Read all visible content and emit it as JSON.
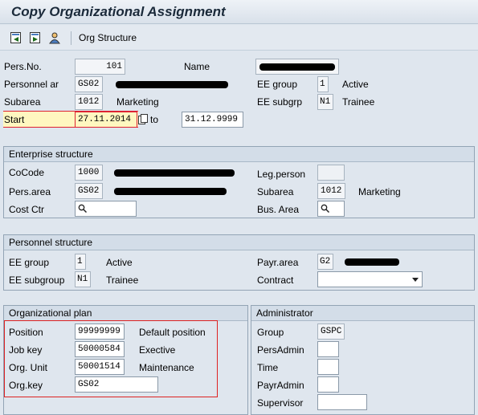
{
  "window": {
    "title": "Copy Organizational Assignment"
  },
  "toolbar": {
    "org_structure_label": "Org Structure"
  },
  "header": {
    "pers_no_label": "Pers.No.",
    "pers_no_value": "101",
    "name_label": "Name",
    "pers_area_label": "Personnel ar",
    "pers_area_value": "GS02",
    "ee_group_label": "EE group",
    "ee_group_value": "1",
    "ee_group_text": "Active",
    "subarea_label": "Subarea",
    "subarea_value": "1012",
    "subarea_text": "Marketing",
    "ee_subgrp_label": "EE subgrp",
    "ee_subgrp_value": "N1",
    "ee_subgrp_text": "Trainee",
    "start_label": "Start",
    "start_value": "27.11.2014",
    "to_label": "to",
    "end_value": "31.12.9999"
  },
  "enterprise": {
    "title": "Enterprise structure",
    "cocode_label": "CoCode",
    "cocode_value": "1000",
    "legperson_label": "Leg.person",
    "persarea_label": "Pers.area",
    "persarea_value": "GS02",
    "subarea_label": "Subarea",
    "subarea_value": "1012",
    "subarea_text": "Marketing",
    "costctr_label": "Cost Ctr",
    "busarea_label": "Bus. Area"
  },
  "personnel": {
    "title": "Personnel structure",
    "eegroup_label": "EE group",
    "eegroup_value": "1",
    "eegroup_text": "Active",
    "payrarea_label": "Payr.area",
    "payrarea_value": "G2",
    "eesubgroup_label": "EE subgroup",
    "eesubgroup_value": "N1",
    "eesubgroup_text": "Trainee",
    "contract_label": "Contract"
  },
  "orgplan": {
    "title": "Organizational plan",
    "position_label": "Position",
    "position_value": "99999999",
    "position_text": "Default position",
    "jobkey_label": "Job key",
    "jobkey_value": "50000584",
    "jobkey_text": "Exective",
    "orgunit_label": "Org. Unit",
    "orgunit_value": "50001514",
    "orgunit_text": "Maintenance",
    "orgkey_label": "Org.key",
    "orgkey_value": "GS02"
  },
  "administrator": {
    "title": "Administrator",
    "group_label": "Group",
    "group_value": "GSPC",
    "persadmin_label": "PersAdmin",
    "time_label": "Time",
    "payradmin_label": "PayrAdmin",
    "supervisor_label": "Supervisor"
  },
  "colors": {
    "highlight_border": "#dd2222",
    "field_highlight": "#fff7c0"
  }
}
